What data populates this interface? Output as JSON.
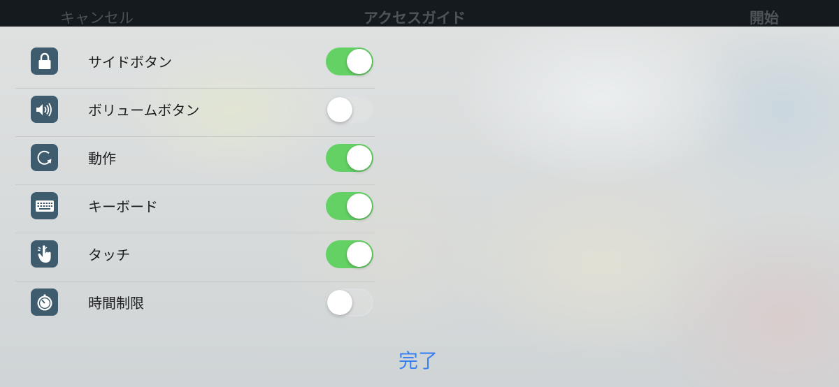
{
  "navbar": {
    "cancel_label": "キャンセル",
    "title": "アクセスガイド",
    "start_label": "開始"
  },
  "options": [
    {
      "label": "サイドボタン",
      "icon": "lock-icon",
      "enabled": true
    },
    {
      "label": "ボリュームボタン",
      "icon": "speaker-volume-icon",
      "enabled": false
    },
    {
      "label": "動作",
      "icon": "rotation-icon",
      "enabled": true
    },
    {
      "label": "キーボード",
      "icon": "keyboard-icon",
      "enabled": true
    },
    {
      "label": "タッチ",
      "icon": "hand-touch-icon",
      "enabled": true
    },
    {
      "label": "時間制限",
      "icon": "timer-icon",
      "enabled": false
    }
  ],
  "done_label": "完了",
  "colors": {
    "toggle_on": "#64d164",
    "icon_background": "#3e5c6e",
    "accent_blue": "#3a82f0",
    "navbar_background": "#141a1e"
  }
}
